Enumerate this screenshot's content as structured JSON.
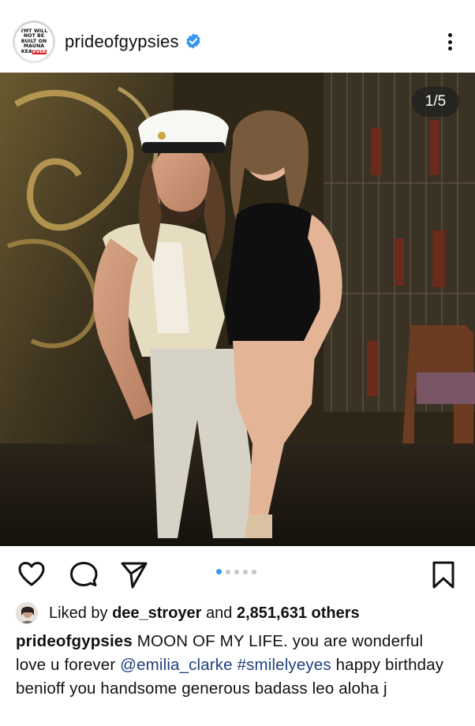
{
  "post": {
    "account": {
      "username": "prideofgypsies",
      "verified": true,
      "avatar_text_lines": [
        "TMT WILL",
        "NOT BE",
        "BUILT ON",
        "MAUNA",
        "KEA"
      ],
      "avatar_tag": "EVER"
    },
    "media": {
      "counter": "1/5",
      "carousel_count": 5,
      "carousel_active_index": 0
    },
    "actions": {
      "like_icon": "heart-icon",
      "comment_icon": "comment-icon",
      "share_icon": "send-icon",
      "save_icon": "bookmark-icon"
    },
    "likes": {
      "prefix": "Liked by",
      "user": "dee_stroyer",
      "middle": "and",
      "count": "2,851,631 others"
    },
    "caption": {
      "author": "prideofgypsies",
      "text_1": "MOON OF MY LIFE. you are wonderful love u forever",
      "mention": "@emilia_clarke",
      "hashtag": "#smilelyeyes",
      "text_2": "happy birthday benioff you handsome generous badass leo aloha j"
    }
  },
  "colors": {
    "accent_blue": "#3897f0",
    "link": "#1f3f7a",
    "verified": "#3897f0",
    "avatar_tag_red": "#d8232a"
  }
}
